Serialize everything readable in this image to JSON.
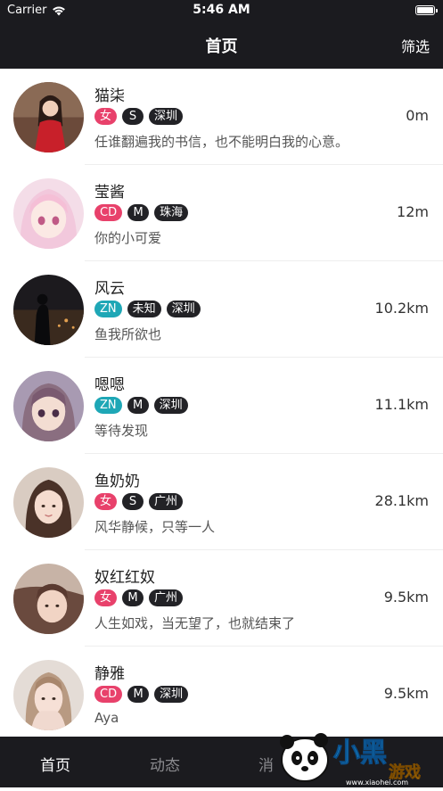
{
  "status": {
    "carrier": "Carrier",
    "time": "5:46 AM"
  },
  "nav": {
    "title": "首页",
    "filter_label": "筛选"
  },
  "users": [
    {
      "name": "猫柒",
      "tags": [
        {
          "text": "女",
          "kind": "gender-f"
        },
        {
          "text": "S",
          "kind": "dark"
        },
        {
          "text": "深圳",
          "kind": "dark"
        }
      ],
      "desc": "任谁翻遍我的书信，也不能明白我的心意。",
      "distance": "0m",
      "avatar": "girl-red-dress"
    },
    {
      "name": "莹酱",
      "tags": [
        {
          "text": "CD",
          "kind": "gender-cd"
        },
        {
          "text": "M",
          "kind": "dark"
        },
        {
          "text": "珠海",
          "kind": "dark"
        }
      ],
      "desc": "你的小可爱",
      "distance": "12m",
      "avatar": "anime-pink-hair"
    },
    {
      "name": "风云",
      "tags": [
        {
          "text": "ZN",
          "kind": "gender-zn"
        },
        {
          "text": "未知",
          "kind": "dark"
        },
        {
          "text": "深圳",
          "kind": "dark"
        }
      ],
      "desc": "鱼我所欲也",
      "distance": "10.2km",
      "avatar": "night-silhouette"
    },
    {
      "name": "嗯嗯",
      "tags": [
        {
          "text": "ZN",
          "kind": "gender-zn"
        },
        {
          "text": "M",
          "kind": "dark"
        },
        {
          "text": "深圳",
          "kind": "dark"
        }
      ],
      "desc": "等待发现",
      "distance": "11.1km",
      "avatar": "anime-girl"
    },
    {
      "name": "鱼奶奶",
      "tags": [
        {
          "text": "女",
          "kind": "gender-f"
        },
        {
          "text": "S",
          "kind": "dark"
        },
        {
          "text": "广州",
          "kind": "dark"
        }
      ],
      "desc": "风华静候，只等一人",
      "distance": "28.1km",
      "avatar": "girl-portrait"
    },
    {
      "name": "奴红红奴",
      "tags": [
        {
          "text": "女",
          "kind": "gender-f"
        },
        {
          "text": "M",
          "kind": "dark"
        },
        {
          "text": "广州",
          "kind": "dark"
        }
      ],
      "desc": "人生如戏，当无望了，也就结束了",
      "distance": "9.5km",
      "avatar": "girl-lying"
    },
    {
      "name": "静雅",
      "tags": [
        {
          "text": "CD",
          "kind": "gender-cd"
        },
        {
          "text": "M",
          "kind": "dark"
        },
        {
          "text": "深圳",
          "kind": "dark"
        }
      ],
      "desc": "Aya",
      "distance": "9.5km",
      "avatar": "girl-hands"
    }
  ],
  "tabbar": {
    "tabs": [
      "首页",
      "动态",
      "消"
    ],
    "active": 0
  },
  "watermark": {
    "main": "小黑",
    "sub": "游戏",
    "url": "www.xiaohei.com"
  },
  "colors": {
    "dark_bar": "#1b1b1f",
    "pink_tag": "#e8416b",
    "teal_tag": "#1ea7b6",
    "dark_tag": "#222226"
  }
}
